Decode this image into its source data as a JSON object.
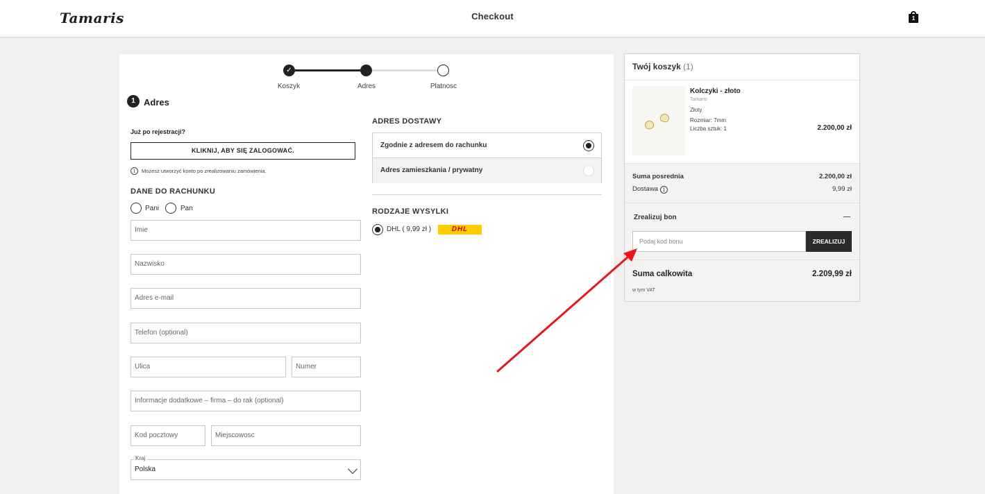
{
  "header": {
    "logo": "Tamaris",
    "title": "Checkout",
    "cart_count": "1"
  },
  "stepper": {
    "steps": [
      "Koszyk",
      "Adres",
      "Platnosc"
    ],
    "done_mark": "✓"
  },
  "section": {
    "number": "1",
    "title": "Adres"
  },
  "login": {
    "question": "Już po rejestracji?",
    "button": "KLIKNIJ, ABY SIĘ ZALOGOWAĆ.",
    "info": "Możesz utworzyć konto po zrealizowaniu zamówienia.",
    "info_icon": "i"
  },
  "billing": {
    "heading": "DANE DO RACHUNKU",
    "salutation": [
      "Pani",
      "Pan"
    ],
    "fields": {
      "first_name": "Imie",
      "last_name": "Nazwisko",
      "email": "Adres e-mail",
      "phone": "Telefon (optional)",
      "street": "Ulica",
      "number": "Numer",
      "additional": "Informacje dodatkowe – firma – do rak (optional)",
      "postal": "Kod pocztowy",
      "city": "Miejscowosc"
    },
    "country": {
      "label": "Kraj",
      "value": "Polska"
    }
  },
  "delivery": {
    "heading": "ADRES DOSTAWY",
    "options": [
      "Zgodnie z adresem do rachunku",
      "Adres zamieszkania / prywatny"
    ],
    "selected": 0
  },
  "shipping": {
    "heading": "RODZAJE WYSYLKI",
    "option": "DHL ( 9,99 zł )",
    "carrier_logo": "DHL"
  },
  "cart": {
    "title": "Twój koszyk",
    "count": "(1)",
    "product": {
      "name": "Kolczyki - złoto",
      "brand": "Tamaris",
      "color": "Złoty",
      "size": "Rozmiar: 7mm",
      "quantity": "Liczba sztuk: 1",
      "price": "2.200,00 zł"
    },
    "subtotal_label": "Suma posrednia",
    "subtotal": "2.200,00 zł",
    "shipping_label": "Dostawa",
    "shipping": "9,99 zł",
    "voucher_title": "Zrealizuj bon",
    "voucher_placeholder": "Podaj kod bonu",
    "voucher_button": "ZREALIZUJ",
    "total_label": "Suma calkowita",
    "total": "2.209,99 zł",
    "vat_note": "w tym VAT"
  },
  "colors": {
    "accent": "#222222",
    "background": "#f1f0ee",
    "annotation_arrow": "#e8161b",
    "dhl_yellow": "#ffcc00",
    "dhl_red": "#d40511"
  }
}
